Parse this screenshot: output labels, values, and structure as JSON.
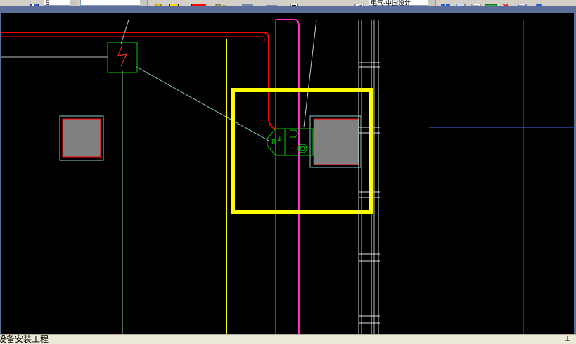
{
  "toolbar": {
    "layer_field": "5",
    "layer_name_field": "",
    "style_field": "电气-中国设计",
    "color_swatch": "#ff0000",
    "icons": [
      "select-icon",
      "layer-icon",
      "layer-dropdown",
      "paint-icon",
      "color-swatch",
      "linetype-icon",
      "lineweight-icon",
      "lineweight-2-icon",
      "print-icon",
      "properties-icon",
      "text-style-icon",
      "grid-icon",
      "table-icon",
      "measure-icon",
      "tool-icon",
      "window-icon",
      "help-icon"
    ]
  },
  "status": {
    "text": "设备安装工程",
    "pin_icon": "pin-icon"
  },
  "drawing": {
    "highlight_color": "#ffff00",
    "wire_red": "#ff0000",
    "wire_magenta": "#ff33cc",
    "wire_cyan": "#88cccc",
    "symbol_green": "#00cc00",
    "wire_yellow": "#ffff00",
    "grid_blue": "#3366ff",
    "box_gray": "#808080"
  }
}
